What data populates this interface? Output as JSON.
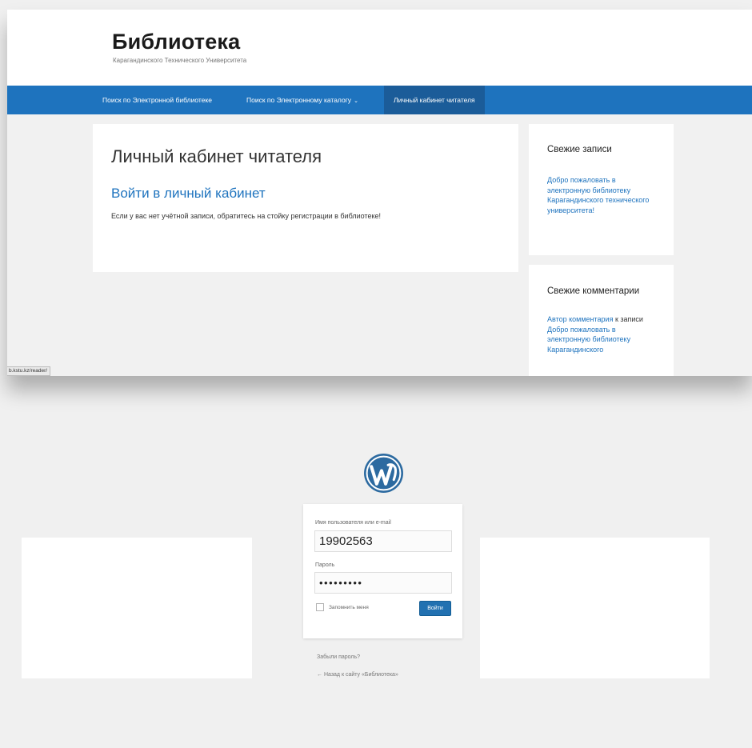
{
  "site": {
    "title": "Библиотека",
    "tagline": "Карагандинского Технического Университета",
    "nav": [
      {
        "label": "Поиск по Электронной библиотеке"
      },
      {
        "label": "Поиск по Электронному каталогу"
      },
      {
        "label": "Личный кабинет читателя"
      }
    ],
    "nav_chevron": "⌄",
    "page_title": "Личный кабинет читателя",
    "login_link": "Войти в личный кабинет",
    "notice": "Если у вас нет учётной записи, обратитесь на стойку регистрации в библиотеке!",
    "recent_posts": {
      "title": "Свежие записи",
      "link": "Добро пожаловать в электронную библиотеку Карагандинского технического университета!"
    },
    "recent_comments": {
      "title": "Свежие комментарии",
      "author": "Автор комментария",
      "middle": " к записи ",
      "post_link": "Добро пожаловать в электронную библиотеку Карагандинского"
    },
    "status_url": "b.kstu.kz/reader/"
  },
  "login": {
    "username_label": "Имя пользователя или e-mail",
    "username_value": "19902563",
    "password_label": "Пароль",
    "password_value": "•••••••••",
    "remember_label": "Запомнить меня",
    "submit_label": "Войти",
    "lost_password": "Забыли пароль?",
    "back_to_site": "← Назад к сайту «Библиотека»"
  },
  "colors": {
    "nav_blue": "#1e73be",
    "nav_active": "#1b5c99",
    "button_blue": "#2271b1"
  }
}
